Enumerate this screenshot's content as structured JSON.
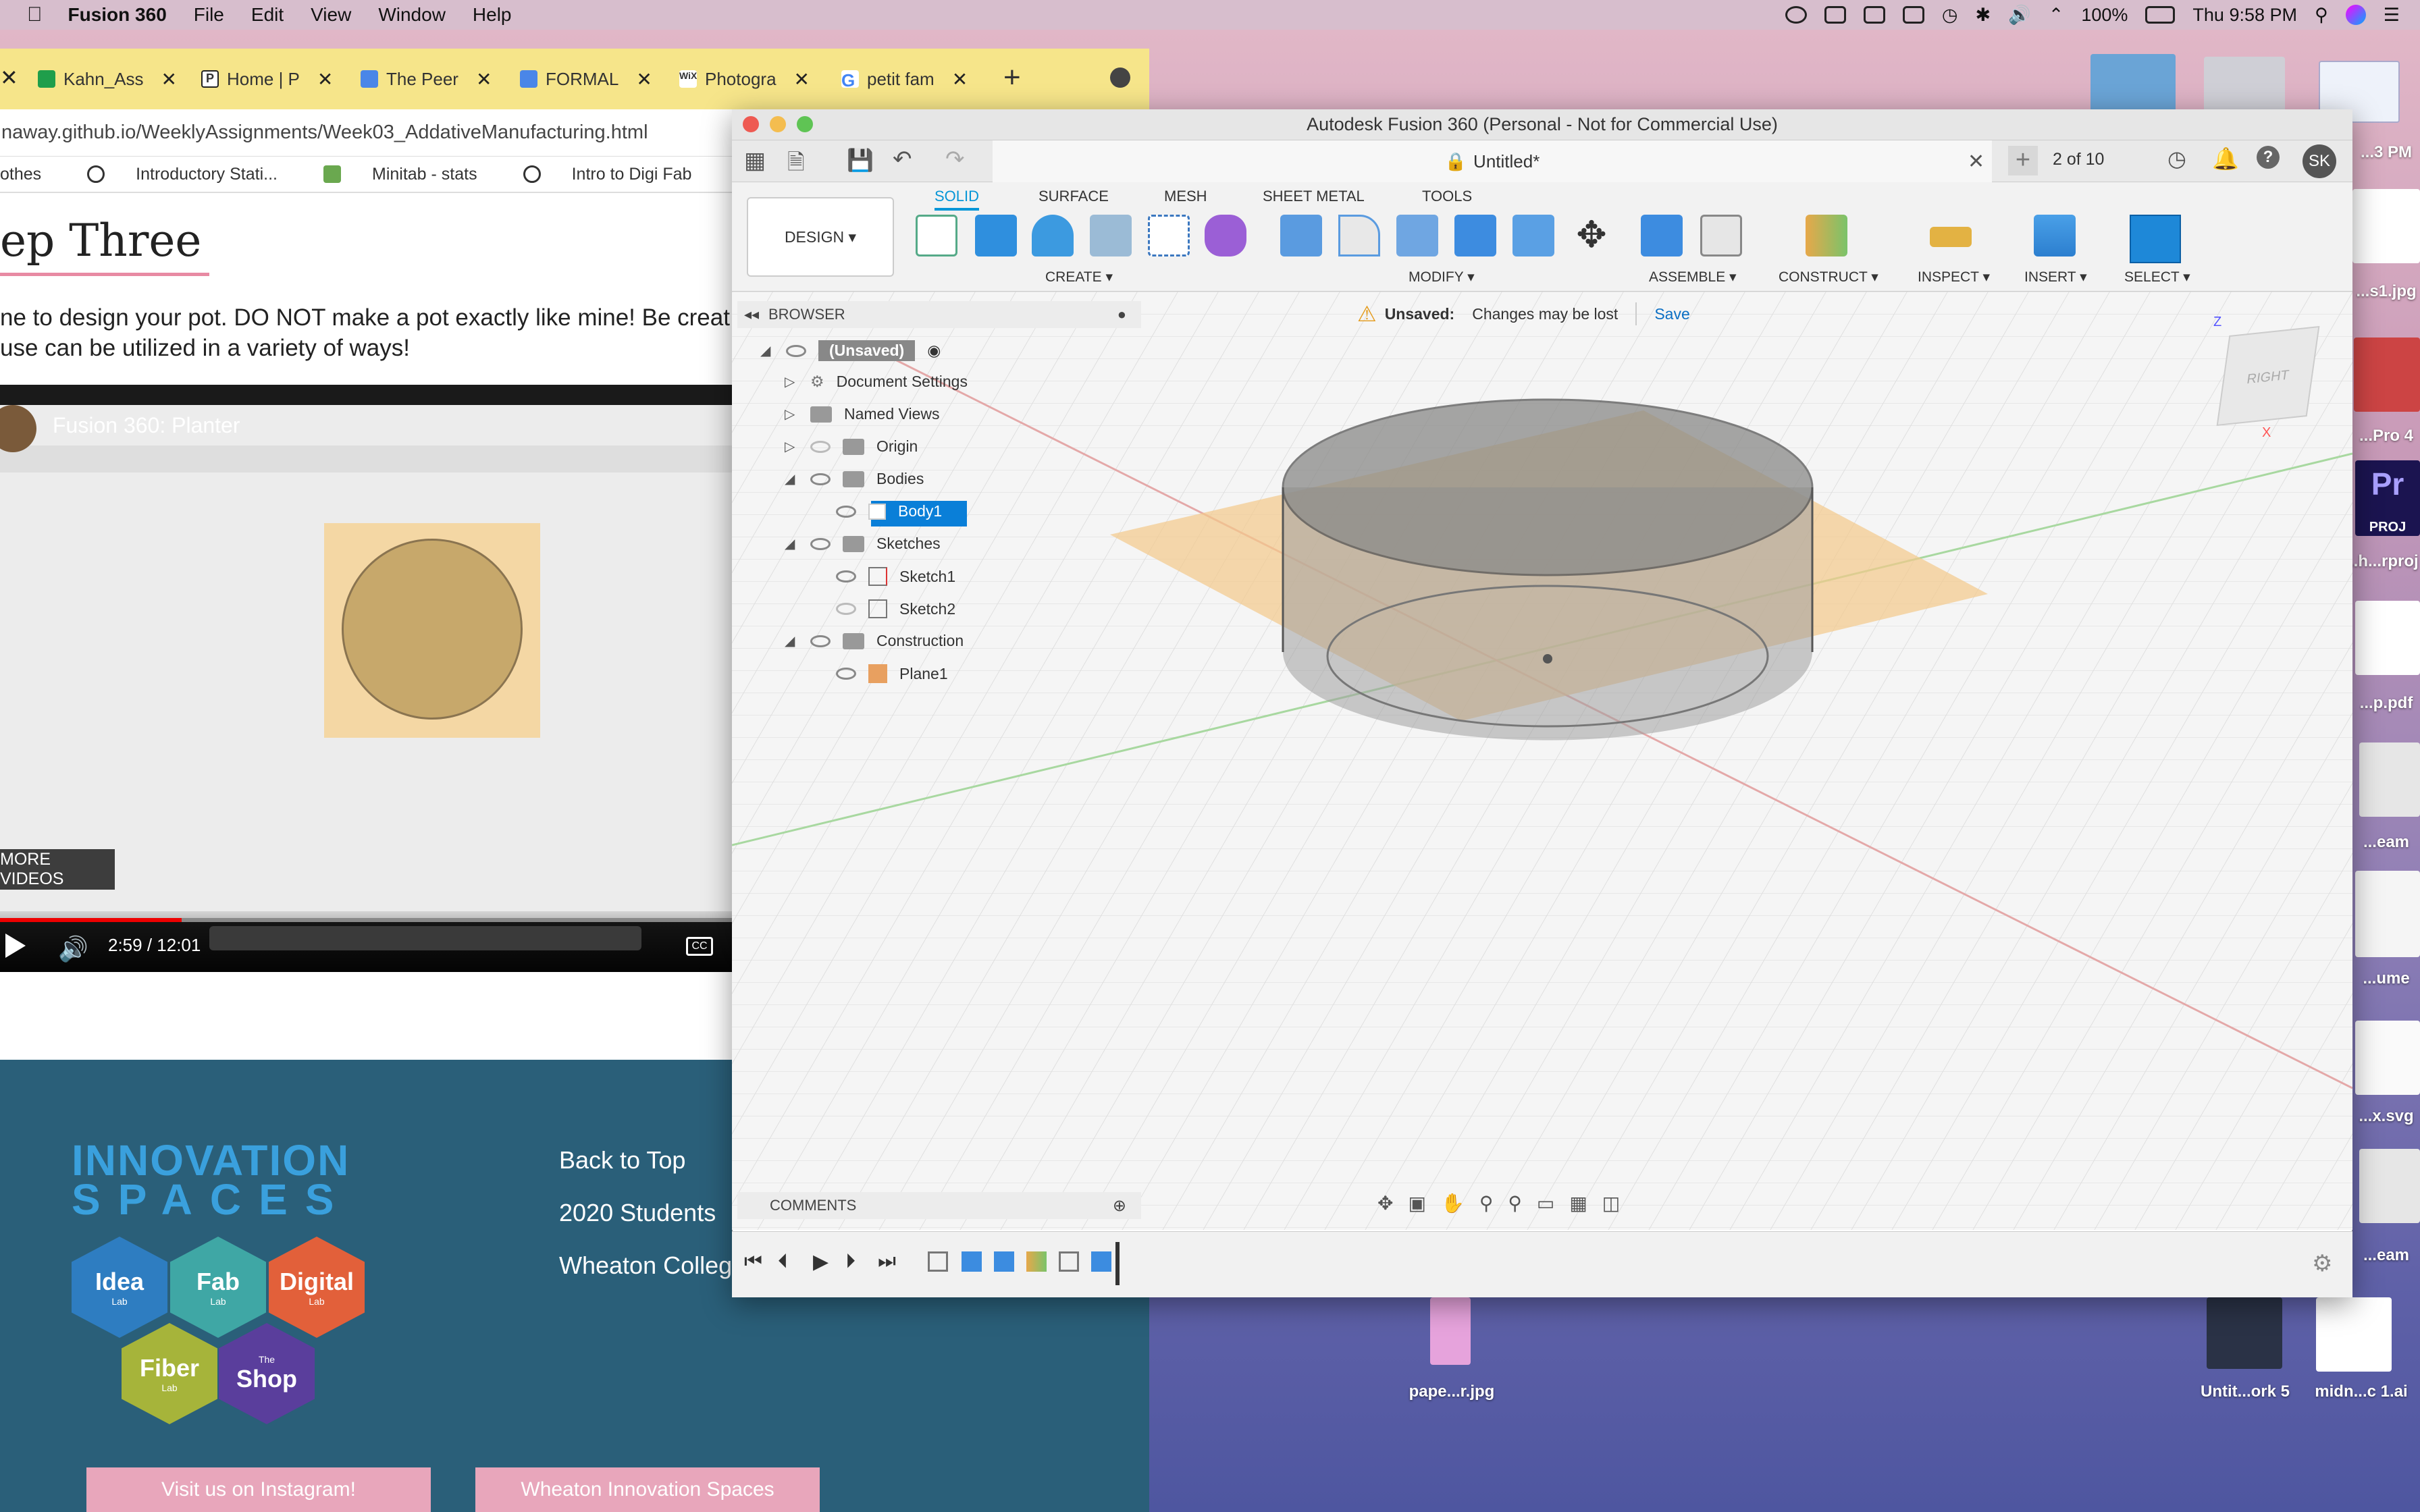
{
  "menubar": {
    "app_name": "Fusion 360",
    "items": [
      "File",
      "Edit",
      "View",
      "Window",
      "Help"
    ],
    "battery": "100%",
    "clock": "Thu 9:58 PM"
  },
  "browser": {
    "tabs": [
      {
        "label": "Kahn_Ass"
      },
      {
        "label": "Home | P"
      },
      {
        "label": "The Peer"
      },
      {
        "label": "FORMAL"
      },
      {
        "label": "Photogra"
      },
      {
        "label": "petit fam"
      }
    ],
    "url": "naway.github.io/WeeklyAssignments/Week03_AddativeManufacturing.html",
    "bookmarks": [
      "othes",
      "Introductory Stati...",
      "Minitab - stats",
      "Intro to Digi Fab"
    ],
    "page": {
      "heading": "ep Three",
      "text_line1": "ne to design your pot. DO NOT make a pot exactly like mine! Be creat",
      "text_line2": " use can be utilized in a variety of ways!"
    },
    "video": {
      "title": "Fusion 360: Planter",
      "more_videos": "MORE VIDEOS",
      "time": "2:59 / 12:01",
      "progress": 0.248,
      "cc": "CC"
    },
    "footer": {
      "logo_line1": "INNOVATION",
      "logo_line2": "SPACES",
      "hexes": [
        {
          "name": "Idea",
          "sub": "Lab",
          "color": "#2e7dc1"
        },
        {
          "name": "Fab",
          "sub": "Lab",
          "color": "#3fa7a5"
        },
        {
          "name": "Digital",
          "sub": "Lab",
          "color": "#e2603a"
        },
        {
          "name": "Fiber",
          "sub": "Lab",
          "color": "#a6b43a"
        },
        {
          "name": "Shop",
          "sub": "The",
          "color": "#5a3e9c"
        }
      ],
      "links": [
        "Back to Top",
        "2020 Students",
        "Wheaton Colleg"
      ],
      "buttons": [
        "Visit us on Instagram!",
        "Wheaton Innovation Spaces"
      ]
    }
  },
  "fusion": {
    "window_title": "Autodesk Fusion 360 (Personal - Not for Commercial Use)",
    "doc_tab": "Untitled*",
    "tab_count": "2 of 10",
    "avatar": "SK",
    "workspace": "DESIGN ▾",
    "ribbon_tabs": [
      "SOLID",
      "SURFACE",
      "MESH",
      "SHEET METAL",
      "TOOLS"
    ],
    "ribbon_groups": [
      "CREATE ▾",
      "MODIFY ▾",
      "ASSEMBLE ▾",
      "CONSTRUCT ▾",
      "INSPECT ▾",
      "INSERT ▾",
      "SELECT ▾"
    ],
    "browser_label": "BROWSER",
    "tree": {
      "root": "(Unsaved)",
      "document_settings": "Document Settings",
      "named_views": "Named Views",
      "origin": "Origin",
      "bodies": "Bodies",
      "body1": "Body1",
      "sketches": "Sketches",
      "sketch1": "Sketch1",
      "sketch2": "Sketch2",
      "construction": "Construction",
      "plane1": "Plane1"
    },
    "warning": {
      "label": "Unsaved:",
      "message": "Changes may be lost",
      "save": "Save"
    },
    "viewcube_face": "RIGHT",
    "comments_label": "COMMENTS"
  },
  "desktop": {
    "icons": [
      {
        "label": "...3 PM"
      },
      {
        "label": "...s1.jpg"
      },
      {
        "label": "...Pro 4"
      },
      {
        "label": "...h...rproj"
      },
      {
        "label": "...p.pdf"
      },
      {
        "label": "...eam"
      },
      {
        "label": "...ume"
      },
      {
        "label": "...x.svg"
      },
      {
        "label": "...eam"
      },
      {
        "label": "pape...r.jpg"
      },
      {
        "label": "Untit...ork 5"
      },
      {
        "label": "midn...c 1.ai"
      }
    ],
    "pr_label": "Pr",
    "pr_sub": "PROJ"
  }
}
